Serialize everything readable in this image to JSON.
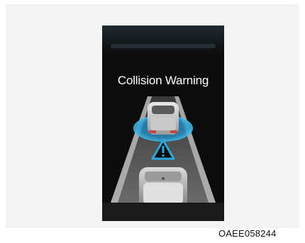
{
  "display": {
    "message": "Collision Warning",
    "icon": "warning-triangle-icon",
    "accent_color": "#2aa9e0",
    "background_color": "#0c0c0c"
  },
  "figure": {
    "code": "OAEE058244"
  }
}
